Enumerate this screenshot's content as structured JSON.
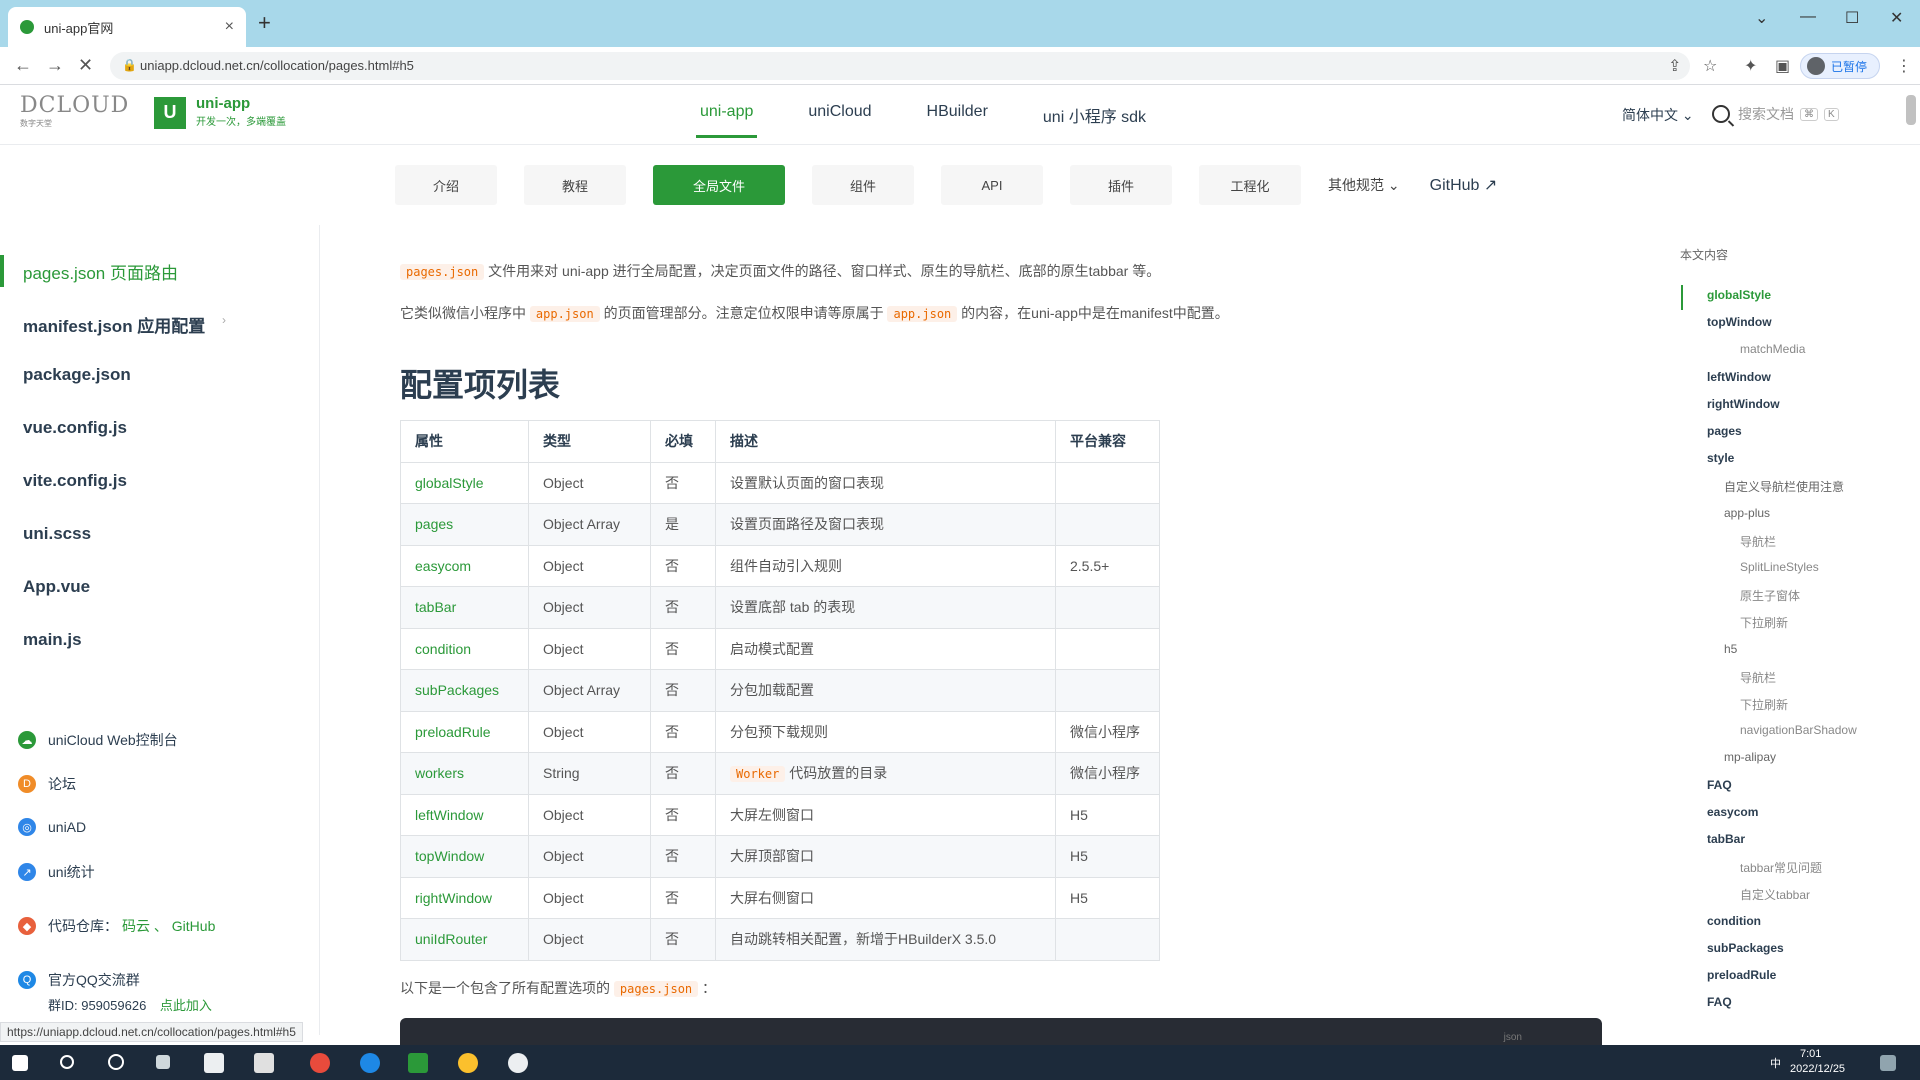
{
  "browser": {
    "tab_title": "uni-app官网",
    "tab_close": "×",
    "new_tab": "+",
    "url": "uniapp.dcloud.net.cn/collocation/pages.html#h5",
    "back": "←",
    "forward": "→",
    "reload": "✕",
    "profile_label": "已暂停",
    "win_min": "—",
    "win_max": "☐",
    "win_close": "✕",
    "win_dropdown": "⌄"
  },
  "header": {
    "dcloud_logo": "DCLOUD",
    "dcloud_sub": "数字天堂",
    "uni_logo_mark": "U",
    "uni_title": "uni-app",
    "uni_slogan": "开发一次，多端覆盖",
    "nav": [
      "uni-app",
      "uniCloud",
      "HBuilder",
      "uni 小程序 sdk"
    ],
    "lang": "简体中文 ⌄",
    "search_placeholder": "搜索文档",
    "search_key1": "⌘",
    "search_key2": "K"
  },
  "subnav": {
    "buttons": [
      "介绍",
      "教程",
      "全局文件",
      "组件",
      "API",
      "插件",
      "工程化"
    ],
    "more": "其他规范 ⌄",
    "github": "GitHub ↗"
  },
  "sidebar": {
    "items": [
      "pages.json 页面路由",
      "manifest.json 应用配置",
      "package.json",
      "vue.config.js",
      "vite.config.js",
      "uni.scss",
      "App.vue",
      "main.js"
    ],
    "manifest_arrow": "›",
    "links": [
      {
        "label": "uniCloud Web控制台",
        "icon": "cloud-icon",
        "color": "#2b9939"
      },
      {
        "label": "论坛",
        "icon": "forum-icon",
        "color": "#f08c28"
      },
      {
        "label": "uniAD",
        "icon": "ad-icon",
        "color": "#2f86e8"
      },
      {
        "label": "uni统计",
        "icon": "stats-icon",
        "color": "#2f86e8"
      }
    ],
    "repo_label": "代码仓库：",
    "repo_links": "码云 、 GitHub",
    "qq_label": "官方QQ交流群",
    "qq_id": "群ID: 959059626",
    "qq_join": "点此加入"
  },
  "content": {
    "intro_code": "pages.json",
    "intro_text": "文件用来对 uni-app 进行全局配置，决定页面文件的路径、窗口样式、原生的导航栏、底部的原生tabbar 等。",
    "intro2_pre": "它类似微信小程序中",
    "intro2_code1": "app.json",
    "intro2_mid": "的页面管理部分。注意定位权限申请等原属于",
    "intro2_code2": "app.json",
    "intro2_post": "的内容，在uni-app中是在manifest中配置。",
    "heading": "配置项列表",
    "table_headers": [
      "属性",
      "类型",
      "必填",
      "描述",
      "平台兼容"
    ],
    "table_rows": [
      [
        "globalStyle",
        "Object",
        "否",
        "设置默认页面的窗口表现",
        ""
      ],
      [
        "pages",
        "Object Array",
        "是",
        "设置页面路径及窗口表现",
        ""
      ],
      [
        "easycom",
        "Object",
        "否",
        "组件自动引入规则",
        "2.5.5+"
      ],
      [
        "tabBar",
        "Object",
        "否",
        "设置底部 tab 的表现",
        ""
      ],
      [
        "condition",
        "Object",
        "否",
        "启动模式配置",
        ""
      ],
      [
        "subPackages",
        "Object Array",
        "否",
        "分包加载配置",
        ""
      ],
      [
        "preloadRule",
        "Object",
        "否",
        "分包预下载规则",
        "微信小程序"
      ],
      [
        "workers",
        "String",
        "否",
        "Worker 代码放置的目录",
        "微信小程序"
      ],
      [
        "leftWindow",
        "Object",
        "否",
        "大屏左侧窗口",
        "H5"
      ],
      [
        "topWindow",
        "Object",
        "否",
        "大屏顶部窗口",
        "H5"
      ],
      [
        "rightWindow",
        "Object",
        "否",
        "大屏右侧窗口",
        "H5"
      ],
      [
        "uniIdRouter",
        "Object",
        "否",
        "自动跳转相关配置，新增于HBuilderX 3.5.0",
        ""
      ]
    ],
    "after_pre": "以下是一个包含了所有配置选项的",
    "after_code": "pages.json",
    "after_post": "：",
    "code_lang": "json"
  },
  "toc": {
    "label": "本文内容",
    "items": [
      {
        "text": "globalStyle",
        "level": 1,
        "active": true
      },
      {
        "text": "topWindow",
        "level": 1
      },
      {
        "text": "matchMedia",
        "level": 3
      },
      {
        "text": "leftWindow",
        "level": 1
      },
      {
        "text": "rightWindow",
        "level": 1
      },
      {
        "text": "pages",
        "level": 1
      },
      {
        "text": "style",
        "level": 1
      },
      {
        "text": "自定义导航栏使用注意",
        "level": 2
      },
      {
        "text": "app-plus",
        "level": 2
      },
      {
        "text": "导航栏",
        "level": 3
      },
      {
        "text": "SplitLineStyles",
        "level": 3
      },
      {
        "text": "原生子窗体",
        "level": 3
      },
      {
        "text": "下拉刷新",
        "level": 3
      },
      {
        "text": "h5",
        "level": 2
      },
      {
        "text": "导航栏",
        "level": 3
      },
      {
        "text": "下拉刷新",
        "level": 3
      },
      {
        "text": "navigationBarShadow",
        "level": 3
      },
      {
        "text": "mp-alipay",
        "level": 2
      },
      {
        "text": "FAQ",
        "level": 1
      },
      {
        "text": "easycom",
        "level": 1
      },
      {
        "text": "tabBar",
        "level": 1
      },
      {
        "text": "tabbar常见问题",
        "level": 3
      },
      {
        "text": "自定义tabbar",
        "level": 3
      },
      {
        "text": "condition",
        "level": 1
      },
      {
        "text": "subPackages",
        "level": 1
      },
      {
        "text": "preloadRule",
        "level": 1
      },
      {
        "text": "FAQ",
        "level": 1
      }
    ]
  },
  "status_url": "https://uniapp.dcloud.net.cn/collocation/pages.html#h5",
  "taskbar": {
    "time": "7:01",
    "date": "2022/12/25",
    "ime": "中"
  },
  "colors": {
    "accent": "#2b9939",
    "code": "#e96900",
    "tabbar_bg": "#a8d8ea",
    "taskbar_bg": "#1c2a3a"
  }
}
